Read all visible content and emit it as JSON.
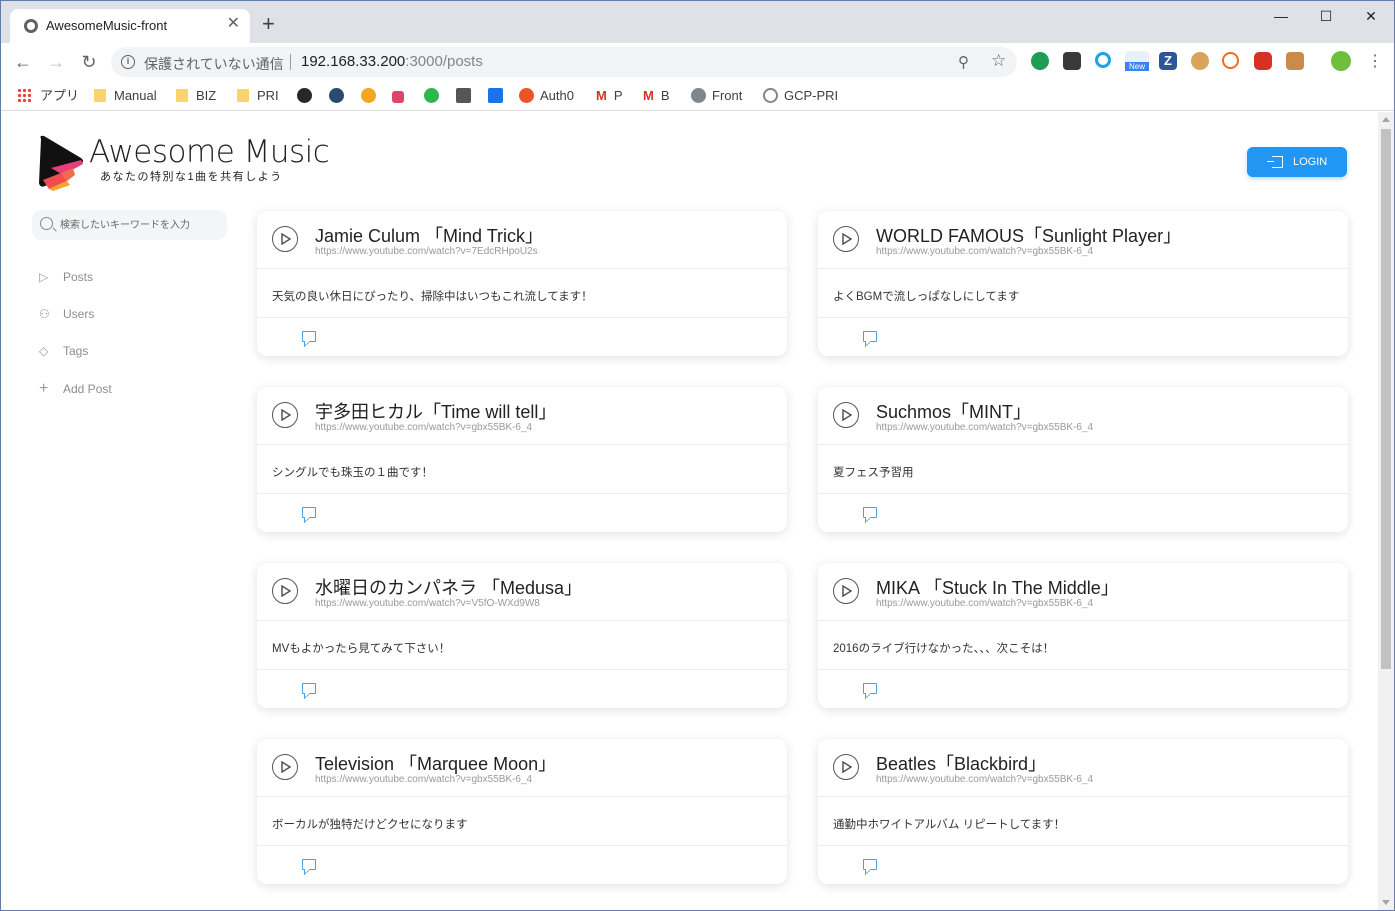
{
  "browser": {
    "tab_title": "AwesomeMusic-front",
    "tab_close": "✕",
    "new_tab": "+",
    "window_controls": [
      "—",
      "☐",
      "✕"
    ],
    "security_text": "保護されていない通信",
    "url_host": "192.168.33.200",
    "url_rest": ":3000/posts",
    "bookmarks": [
      {
        "label": "アプリ",
        "icon": "apps-icon"
      },
      {
        "label": "Manual",
        "icon": "folder-icon"
      },
      {
        "label": "BIZ",
        "icon": "folder-icon"
      },
      {
        "label": "PRI",
        "icon": "folder-icon"
      },
      {
        "label": "",
        "icon": "github-icon"
      },
      {
        "label": "",
        "icon": "docker-icon"
      },
      {
        "label": "",
        "icon": "co-icon"
      },
      {
        "label": "",
        "icon": "qiita-icon"
      },
      {
        "label": "",
        "icon": "ac-icon"
      },
      {
        "label": "",
        "icon": "tool-icon"
      },
      {
        "label": "",
        "icon": "calendar-icon"
      },
      {
        "label": "Auth0",
        "icon": "auth0-icon"
      },
      {
        "label": "P",
        "icon": "gmail-icon"
      },
      {
        "label": "B",
        "icon": "gmail-icon"
      },
      {
        "label": "Front",
        "icon": "globe-icon"
      },
      {
        "label": "GCP-PRI",
        "icon": "gcp-icon"
      }
    ],
    "extension_new_badge": "New",
    "extension_z": "Z"
  },
  "app": {
    "brand": "Awesome Music",
    "tagline": "あなたの特別な1曲を共有しよう",
    "login_label": "LOGIN",
    "search_placeholder": "検索したいキーワードを入力",
    "nav": [
      {
        "label": "Posts",
        "icon": "play-outline-icon"
      },
      {
        "label": "Users",
        "icon": "users-icon"
      },
      {
        "label": "Tags",
        "icon": "tag-icon"
      },
      {
        "label": "Add Post",
        "icon": "plus-icon"
      }
    ],
    "posts": [
      {
        "title": "Jamie Culum 「Mind Trick」",
        "url": "https://www.youtube.com/watch?v=7EdcRHpoU2s",
        "comment": "天気の良い休日にぴったり、掃除中はいつもこれ流してます！"
      },
      {
        "title": "WORLD FAMOUS「Sunlight Player」",
        "url": "https://www.youtube.com/watch?v=gbx55BK-6_4",
        "comment": "よくBGMで流しっぱなしにしてます"
      },
      {
        "title": "宇多田ヒカル「Time will tell」",
        "url": "https://www.youtube.com/watch?v=gbx55BK-6_4",
        "comment": "シングルでも珠玉の１曲です！"
      },
      {
        "title": "Suchmos「MINT」",
        "url": "https://www.youtube.com/watch?v=gbx55BK-6_4",
        "comment": "夏フェス予習用"
      },
      {
        "title": "水曜日のカンパネラ 「Medusa」",
        "url": "https://www.youtube.com/watch?v=V5fO-WXd9W8",
        "comment": "MVもよかったら見てみて下さい！"
      },
      {
        "title": "MIKA 「Stuck In The Middle」",
        "url": "https://www.youtube.com/watch?v=gbx55BK-6_4",
        "comment": "2016のライブ行けなかった、、、次こそは！"
      },
      {
        "title": "Television 「Marquee Moon」",
        "url": "https://www.youtube.com/watch?v=gbx55BK-6_4",
        "comment": "ボーカルが独特だけどクセになります"
      },
      {
        "title": "Beatles「Blackbird」",
        "url": "https://www.youtube.com/watch?v=gbx55BK-6_4",
        "comment": "通勤中ホワイトアルバム リピートしてます！"
      }
    ]
  },
  "colors": {
    "accent": "#2196f3",
    "comment_icon": "#4a9fe0"
  }
}
